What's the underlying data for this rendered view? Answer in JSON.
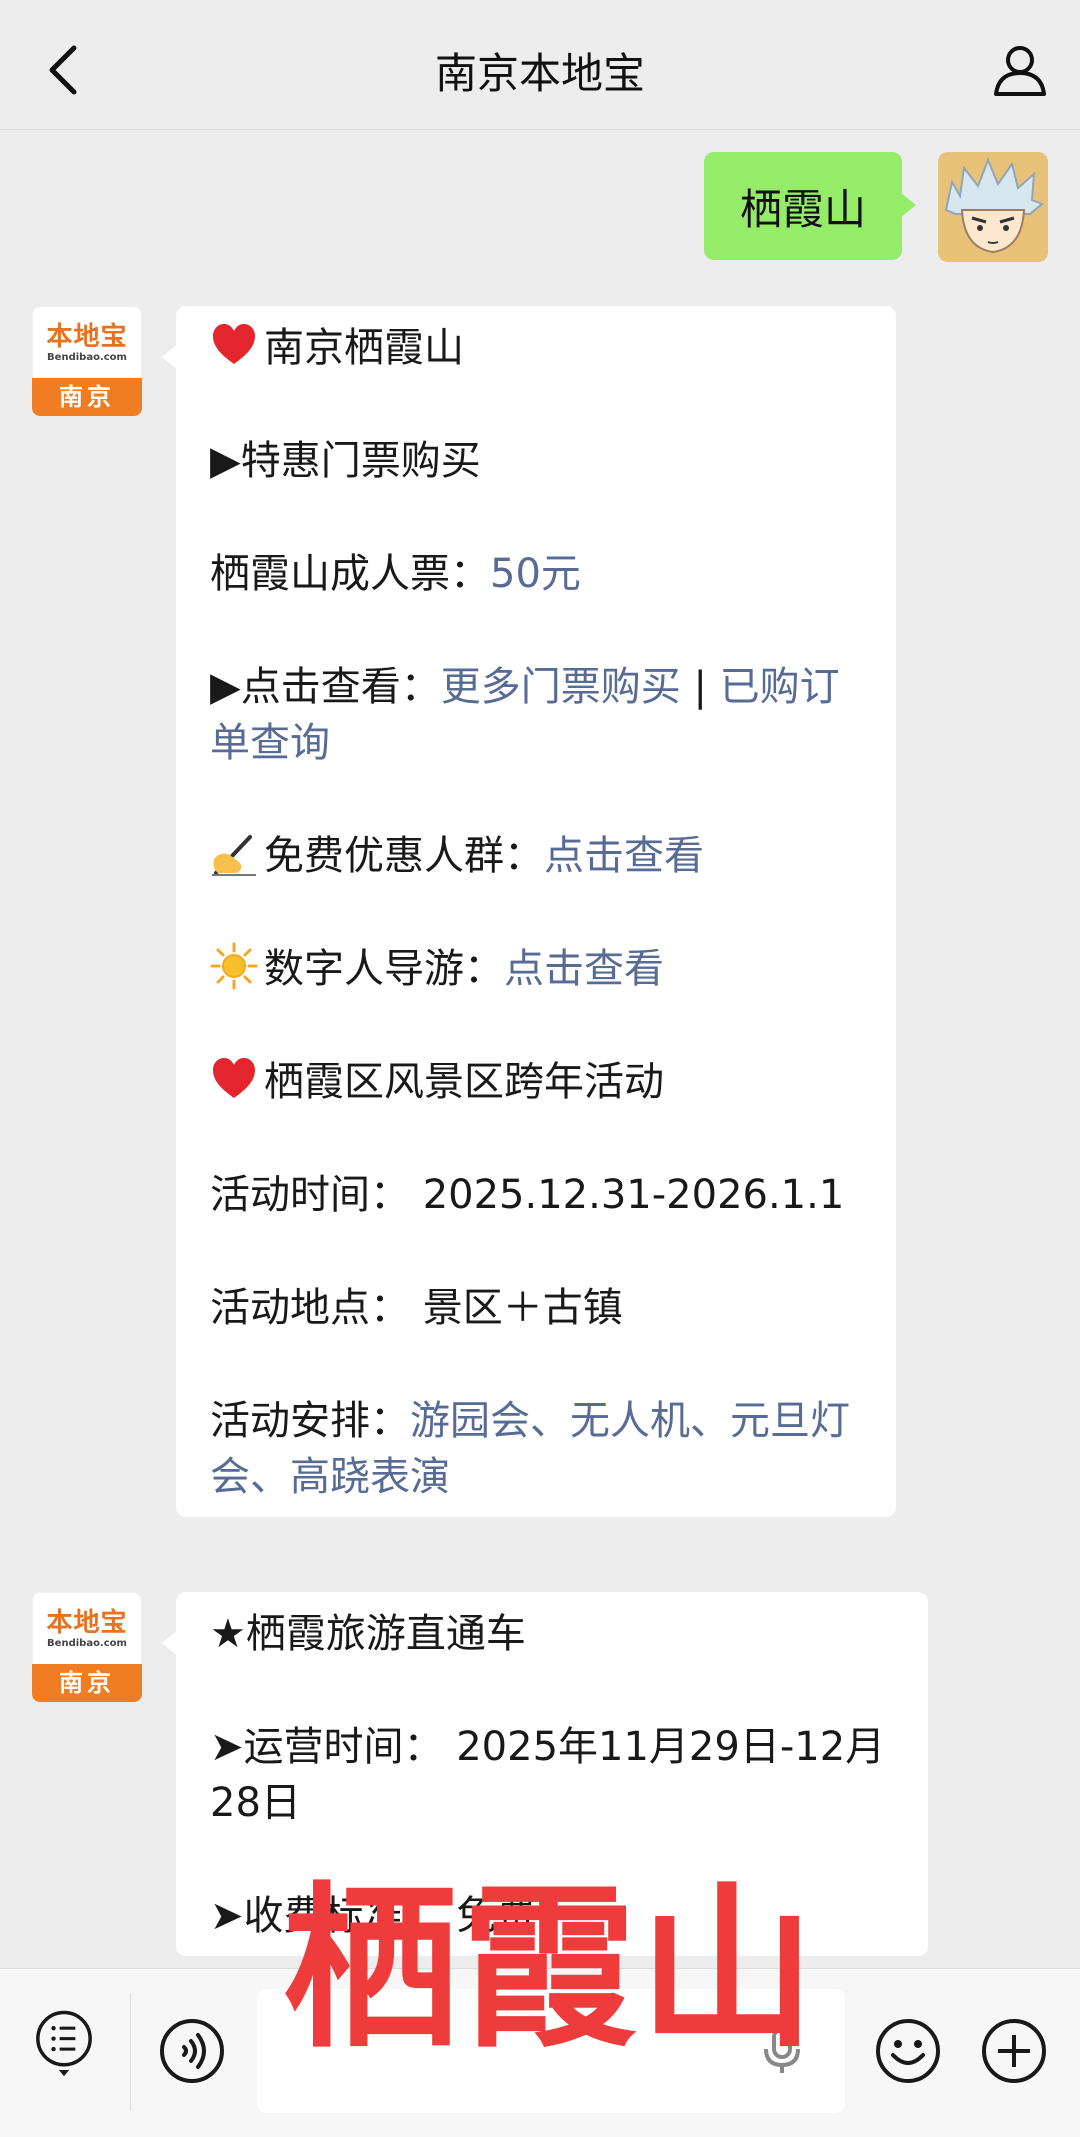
{
  "header": {
    "title": "南京本地宝"
  },
  "user_message": {
    "text": "栖霞山"
  },
  "bot_avatar": {
    "brand": "本地宝",
    "url": "Bendibao.com",
    "city": "南京"
  },
  "message1": {
    "l1": "南京栖霞山",
    "l2": "▶特惠门票购买",
    "l3_label": "栖霞山成人票：",
    "l3_link": "50元",
    "l4_label": "▶点击查看：",
    "l4_link1": "更多门票购买",
    "l4_sep": " | ",
    "l4_link2": "已购订单查询",
    "l5_label": "免费优惠人群：",
    "l5_link": "点击查看",
    "l6_label": "数字人导游：",
    "l6_link": "点击查看",
    "l7": "栖霞区风景区跨年活动",
    "l8": "活动时间：  2025.12.31-2026.1.1",
    "l9": "活动地点：  景区＋古镇",
    "l10_label": "活动安排：",
    "l10_link": "游园会、无人机、元旦灯会、高跷表演"
  },
  "message2": {
    "l1": "★栖霞旅游直通车",
    "l2": "➤运营时间：  2025年11月29日-12月28日",
    "l3": "➤收费标准：  免费"
  },
  "watermark": "栖霞山",
  "icons": [
    "back-icon",
    "profile-icon",
    "menu-icon",
    "voice-icon",
    "mic-icon",
    "emoji-icon",
    "plus-icon",
    "heart-icon",
    "writing-hand-icon",
    "sun-icon"
  ],
  "colors": {
    "link": "#576b95",
    "user_bubble": "#95ec69",
    "watermark": "#ee3b3b",
    "brand_orange": "#f07d24"
  }
}
